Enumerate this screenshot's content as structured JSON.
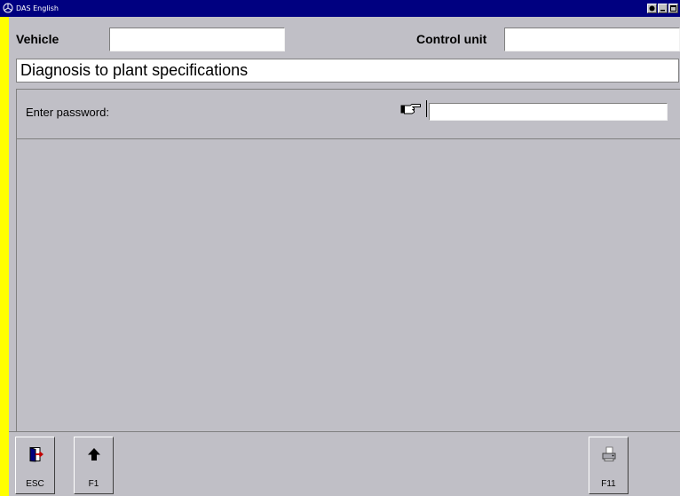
{
  "window": {
    "title": "DAS English",
    "accent": "#000080",
    "background": "#ffff00",
    "icons": {
      "app": "mercedes-star-icon",
      "minimize": "minimize-icon",
      "restore": "restore-icon",
      "close": "close-icon"
    }
  },
  "header": {
    "vehicle_label": "Vehicle",
    "vehicle_value": "",
    "control_unit_label": "Control unit",
    "control_unit_value": ""
  },
  "caption": "Diagnosis to plant specifications",
  "form": {
    "password_label": "Enter password:",
    "password_value": "",
    "pointer_icon": "pointing-hand-icon"
  },
  "function_keys": [
    {
      "label": "ESC",
      "icon": "exit-door-icon"
    },
    {
      "label": "F1",
      "icon": "up-arrow-icon"
    },
    {
      "label": "F11",
      "icon": "printer-icon"
    }
  ]
}
